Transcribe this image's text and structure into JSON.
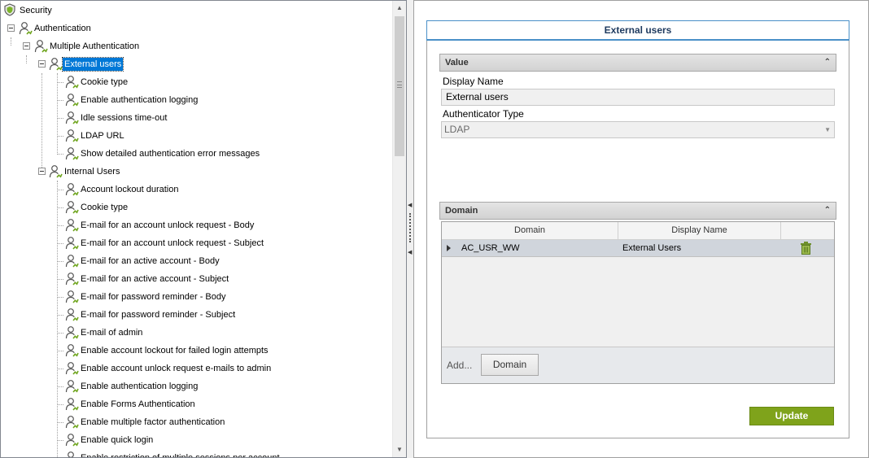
{
  "tree": {
    "nodes": [
      {
        "label": "Security",
        "level": 0,
        "type": "root"
      },
      {
        "label": "Authentication",
        "level": 1,
        "type": "folder"
      },
      {
        "label": "Multiple Authentication",
        "level": 2,
        "type": "folder"
      },
      {
        "label": "External users",
        "level": 3,
        "type": "folder",
        "selected": true
      },
      {
        "label": "Cookie type",
        "level": 4,
        "type": "leaf"
      },
      {
        "label": "Enable authentication logging",
        "level": 4,
        "type": "leaf"
      },
      {
        "label": "Idle sessions time-out",
        "level": 4,
        "type": "leaf"
      },
      {
        "label": "LDAP URL",
        "level": 4,
        "type": "leaf"
      },
      {
        "label": "Show detailed authentication error messages",
        "level": 4,
        "type": "leaf"
      },
      {
        "label": "Internal Users",
        "level": 3,
        "type": "folder"
      },
      {
        "label": "Account lockout duration",
        "level": 4,
        "type": "leaf"
      },
      {
        "label": "Cookie type",
        "level": 4,
        "type": "leaf"
      },
      {
        "label": "E-mail for an account unlock request - Body",
        "level": 4,
        "type": "leaf"
      },
      {
        "label": "E-mail for an account unlock request - Subject",
        "level": 4,
        "type": "leaf"
      },
      {
        "label": "E-mail for an active account - Body",
        "level": 4,
        "type": "leaf"
      },
      {
        "label": "E-mail for an active account - Subject",
        "level": 4,
        "type": "leaf"
      },
      {
        "label": "E-mail for password reminder - Body",
        "level": 4,
        "type": "leaf"
      },
      {
        "label": "E-mail for password reminder - Subject",
        "level": 4,
        "type": "leaf"
      },
      {
        "label": "E-mail of admin",
        "level": 4,
        "type": "leaf"
      },
      {
        "label": "Enable account lockout for failed login attempts",
        "level": 4,
        "type": "leaf"
      },
      {
        "label": "Enable account unlock request e-mails to admin",
        "level": 4,
        "type": "leaf"
      },
      {
        "label": "Enable authentication logging",
        "level": 4,
        "type": "leaf"
      },
      {
        "label": "Enable Forms Authentication",
        "level": 4,
        "type": "leaf"
      },
      {
        "label": "Enable multiple factor authentication",
        "level": 4,
        "type": "leaf"
      },
      {
        "label": "Enable quick login",
        "level": 4,
        "type": "leaf"
      },
      {
        "label": "Enable restriction of multiple sessions per account",
        "level": 4,
        "type": "leaf"
      }
    ]
  },
  "panel": {
    "title": "External users",
    "value_section": {
      "header": "Value",
      "display_name_label": "Display Name",
      "display_name_value": "External users",
      "authenticator_type_label": "Authenticator Type",
      "authenticator_type_value": "LDAP"
    },
    "domain_section": {
      "header": "Domain",
      "columns": [
        "Domain",
        "Display Name",
        ""
      ],
      "rows": [
        {
          "domain": "AC_USR_WW",
          "display_name": "External Users"
        }
      ],
      "add_label": "Add...",
      "add_button_label": "Domain"
    },
    "update_button_label": "Update"
  },
  "colors": {
    "selection": "#0078d7",
    "accent_border": "#4a90c8",
    "update_button": "#7fa31b",
    "title_text": "#1e3a5f"
  }
}
